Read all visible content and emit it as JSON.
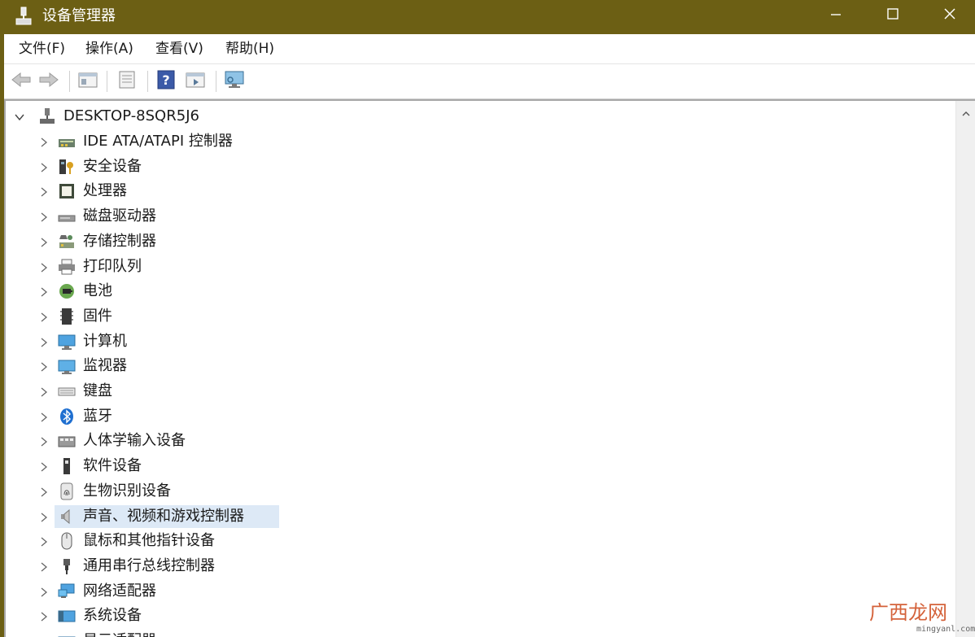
{
  "window": {
    "title": "设备管理器",
    "controls": {
      "minimize": "minimize",
      "maximize": "maximize",
      "close": "close"
    }
  },
  "menubar": {
    "items": [
      {
        "label": "文件(F)"
      },
      {
        "label": "操作(A)"
      },
      {
        "label": "查看(V)"
      },
      {
        "label": "帮助(H)"
      }
    ]
  },
  "toolbar": {
    "buttons": [
      {
        "icon": "back-arrow-icon"
      },
      {
        "icon": "forward-arrow-icon"
      },
      {
        "icon": "show-hide-console-tree-icon"
      },
      {
        "icon": "properties-icon"
      },
      {
        "icon": "help-icon"
      },
      {
        "icon": "run-action-icon"
      },
      {
        "icon": "monitor-scan-icon"
      }
    ]
  },
  "tree": {
    "root": {
      "label": "DESKTOP-8SQR5J6",
      "expanded": true,
      "icon": "computer-network-icon"
    },
    "items": [
      {
        "label": "IDE ATA/ATAPI 控制器",
        "icon": "ide-controller-icon"
      },
      {
        "label": "安全设备",
        "icon": "security-device-icon"
      },
      {
        "label": "处理器",
        "icon": "processor-icon"
      },
      {
        "label": "磁盘驱动器",
        "icon": "disk-drive-icon"
      },
      {
        "label": "存储控制器",
        "icon": "storage-controller-icon"
      },
      {
        "label": "打印队列",
        "icon": "printer-icon"
      },
      {
        "label": "电池",
        "icon": "battery-icon"
      },
      {
        "label": "固件",
        "icon": "firmware-icon"
      },
      {
        "label": "计算机",
        "icon": "computer-icon"
      },
      {
        "label": "监视器",
        "icon": "monitor-icon"
      },
      {
        "label": "键盘",
        "icon": "keyboard-icon"
      },
      {
        "label": "蓝牙",
        "icon": "bluetooth-icon"
      },
      {
        "label": "人体学输入设备",
        "icon": "hid-icon"
      },
      {
        "label": "软件设备",
        "icon": "software-device-icon"
      },
      {
        "label": "生物识别设备",
        "icon": "fingerprint-icon"
      },
      {
        "label": "声音、视频和游戏控制器",
        "icon": "speaker-icon",
        "selected": true
      },
      {
        "label": "鼠标和其他指针设备",
        "icon": "mouse-icon"
      },
      {
        "label": "通用串行总线控制器",
        "icon": "usb-icon"
      },
      {
        "label": "网络适配器",
        "icon": "network-adapter-icon"
      },
      {
        "label": "系统设备",
        "icon": "system-device-icon"
      },
      {
        "label": "显示适配器",
        "icon": "display-adapter-icon"
      }
    ]
  },
  "watermark": {
    "logo": "广西龙网",
    "url": "mingyanl.com"
  },
  "colors": {
    "titlebar": "#6c5f14",
    "selection": "#dde9f6",
    "text": "#1a1a1a"
  }
}
